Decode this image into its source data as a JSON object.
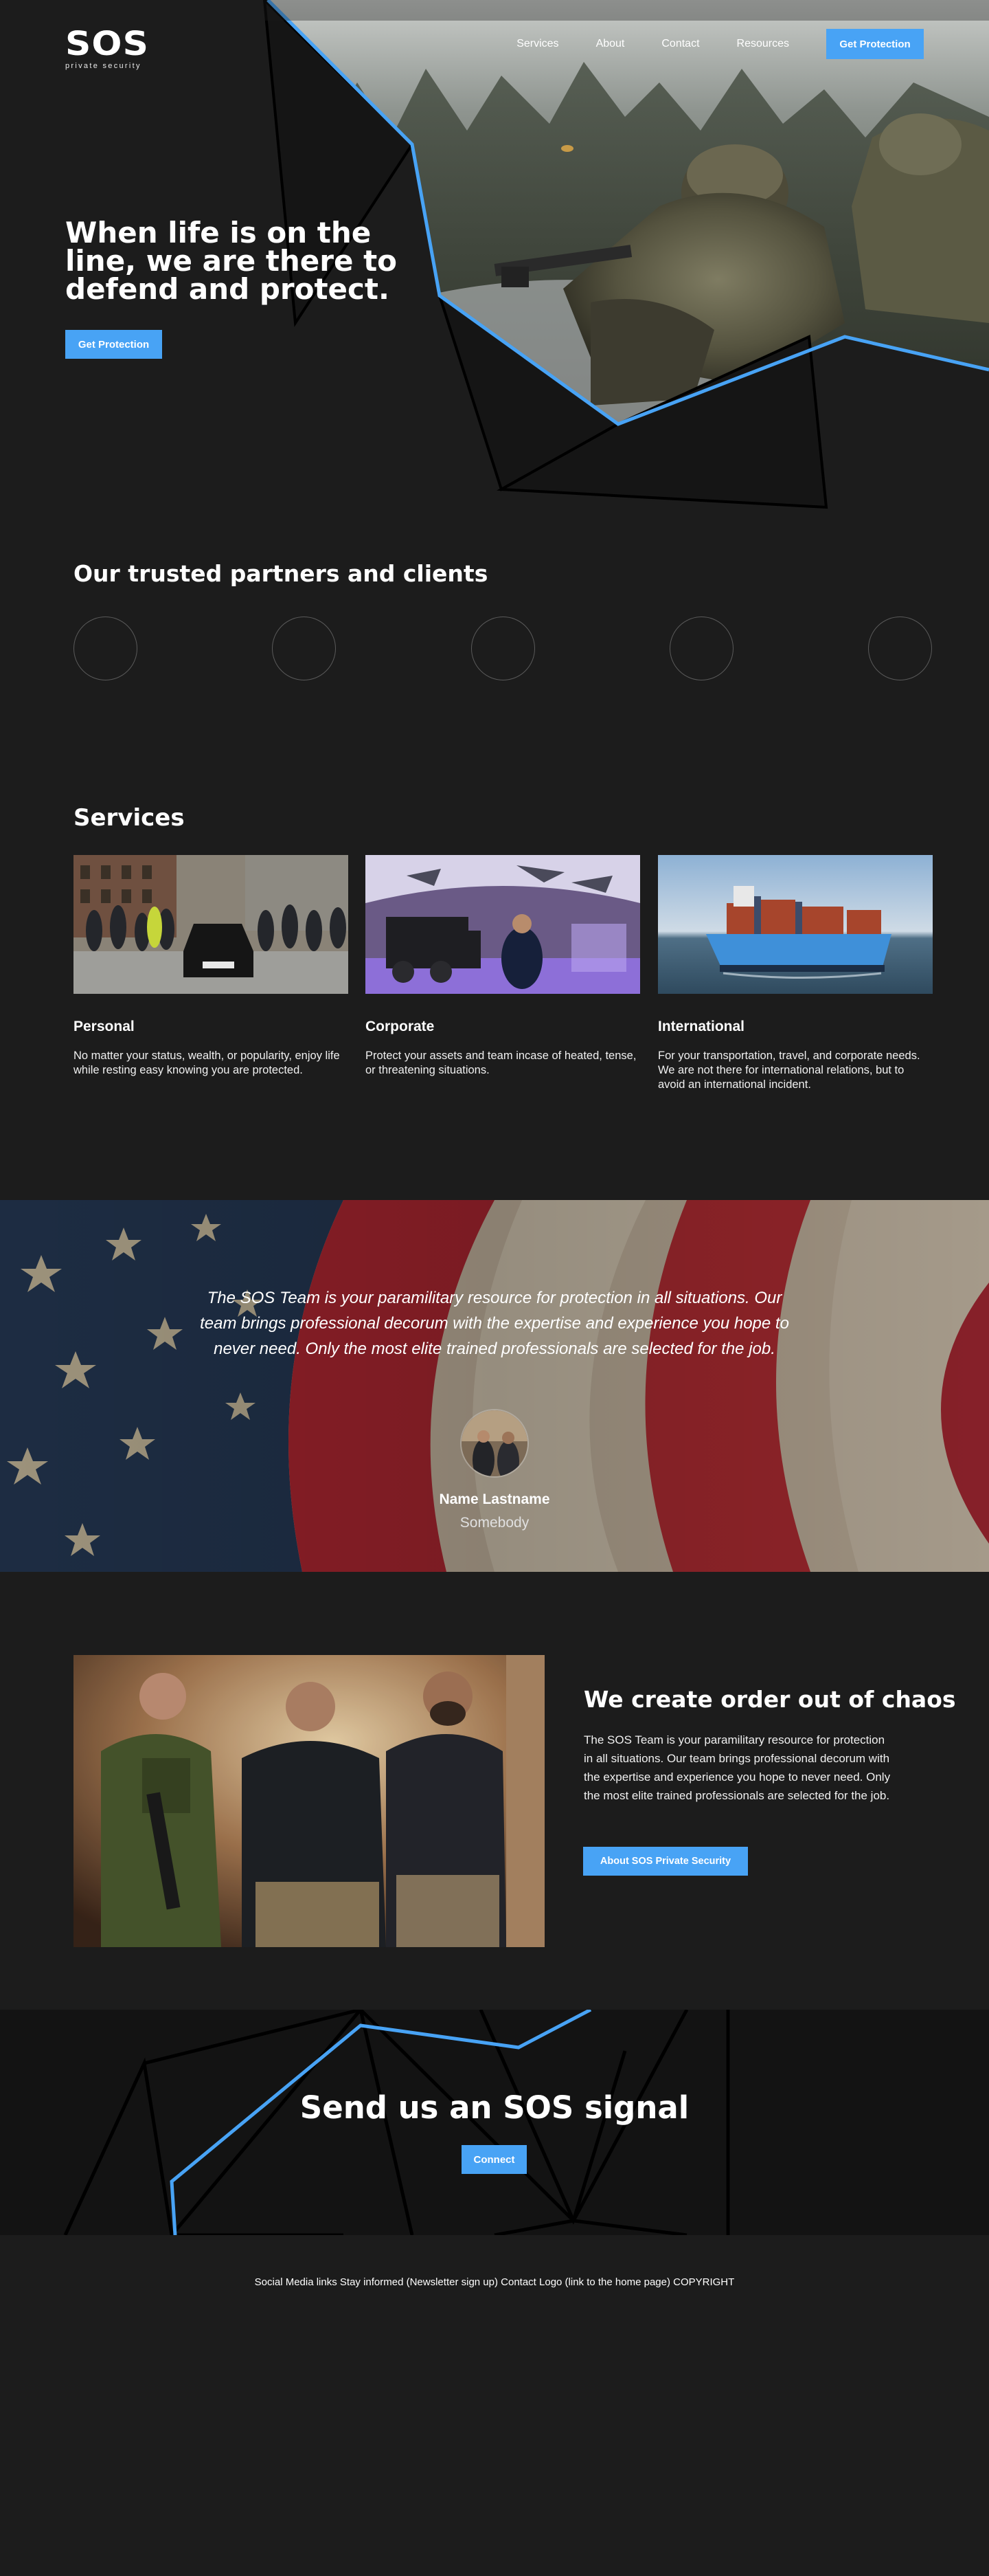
{
  "brand": {
    "logo": "SOS",
    "tagline": "private security"
  },
  "nav": {
    "links": [
      "Services",
      "About",
      "Contact",
      "Resources"
    ],
    "cta": "Get Protection"
  },
  "hero": {
    "title": "When life is on the line, we are there to defend and protect.",
    "cta": "Get Protection",
    "accent_color": "#48a3f5"
  },
  "partners": {
    "title": "Our trusted partners and clients",
    "count": 5
  },
  "services": {
    "title": "Services",
    "items": [
      {
        "name": "Personal",
        "description": "No matter your status, wealth, or popularity, enjoy life while resting easy knowing you are protected."
      },
      {
        "name": "Corporate",
        "description": "Protect your assets and team incase of heated, tense, or threatening situations."
      },
      {
        "name": "International",
        "description": "For your transportation, travel, and corporate needs. We are not there for international relations, but to avoid an international incident."
      }
    ]
  },
  "testimonial": {
    "quote": "The SOS Team is your paramilitary resource for protection in all situations. Our team brings professional decorum with the expertise and experience you hope to never need. Only the most elite trained professionals are selected for the job.",
    "name": "Name Lastname",
    "role": "Somebody"
  },
  "about": {
    "title": "We create order out of chaos",
    "body": "The SOS Team is your paramilitary resource for protection in all situations. Our team brings professional decorum with the expertise and experience you hope to never need. Only the most elite trained professionals are selected for the job.",
    "cta": "About SOS Private Security"
  },
  "signal": {
    "title": "Send us an SOS signal",
    "cta": "Connect"
  },
  "footer": {
    "text": "Social Media links Stay informed (Newsletter sign up)  Contact Logo (link to the home page) COPYRIGHT"
  },
  "colors": {
    "accent": "#48a3f5",
    "background": "#1c1c1c",
    "signal_bg": "#131313"
  }
}
